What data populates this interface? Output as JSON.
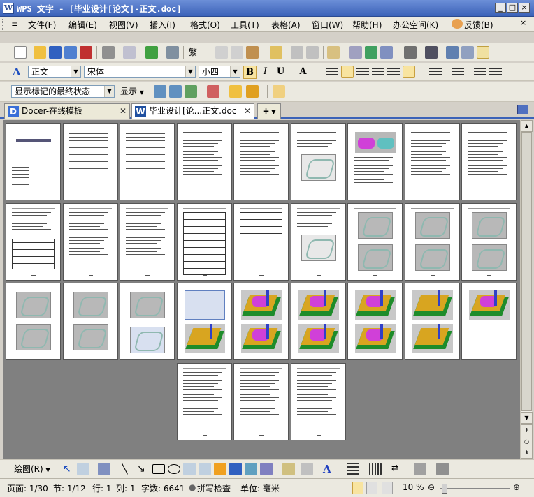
{
  "window": {
    "title": "WPS 文字 - [毕业设计[论文]-正文.doc]",
    "app_icon_letter": "W"
  },
  "menubar": {
    "items": [
      "文件(F)",
      "编辑(E)",
      "视图(V)",
      "插入(I)",
      "格式(O)",
      "工具(T)",
      "表格(A)",
      "窗口(W)",
      "帮助(H)",
      "办公空间(K)",
      "反馈(B)"
    ]
  },
  "format_toolbar": {
    "style_value": "正文",
    "font_value": "宋体",
    "size_value": "小四",
    "bold": "B",
    "italic": "I",
    "underline": "U",
    "font_color": "A"
  },
  "review_toolbar": {
    "markup_value": "显示标记的最终状态",
    "show_label": "显示"
  },
  "tabs": [
    {
      "label": "Docer-在线模板",
      "icon": "D",
      "active": false
    },
    {
      "label": "毕业设计[论...正文.doc",
      "icon": "W",
      "active": true
    }
  ],
  "new_tab_label": "+",
  "drawbar": {
    "draw_label": "绘图(R)"
  },
  "status": {
    "page": "页面: 1/30",
    "section": "节: 1/12",
    "row": "行: 1",
    "col": "列: 1",
    "wordcount": "字数: 6641",
    "spellcheck": "拼写检查",
    "unit": "单位: 毫米",
    "zoom": "10 %"
  },
  "thumbnails": {
    "count": 30,
    "types": [
      "cover",
      "toc",
      "toc",
      "text",
      "text",
      "text-img",
      "color-img",
      "text",
      "text",
      "text-table",
      "text",
      "text",
      "table",
      "table",
      "text-img",
      "gray2",
      "gray2",
      "gray2",
      "gray2",
      "gray2",
      "gray-screens",
      "screens-cad",
      "cad2",
      "cad2",
      "cad2",
      "cad2",
      "cad1",
      "text",
      "text",
      "text"
    ]
  },
  "colors": {
    "title_bar": "#3b62b8",
    "doc_background": "#808080",
    "cad_green": "#1e8c2a",
    "cad_yellow": "#d8a520",
    "cad_magenta": "#d040d8"
  }
}
